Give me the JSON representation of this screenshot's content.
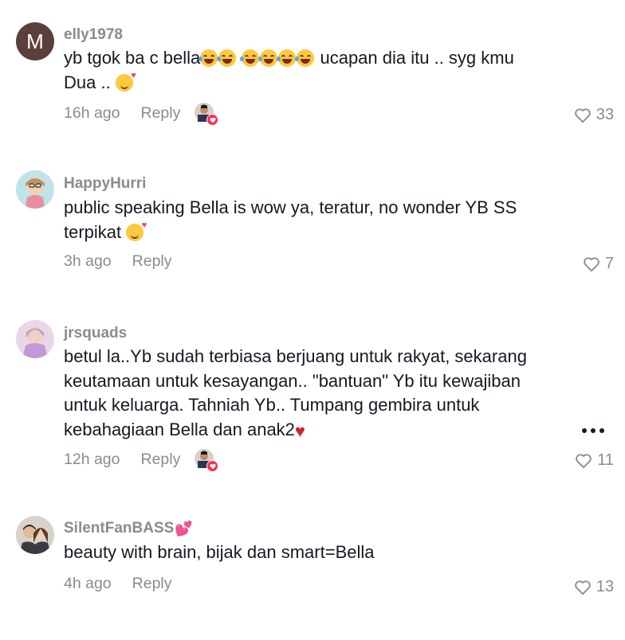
{
  "comments": [
    {
      "username": "elly1978",
      "avatar_letter": "M",
      "line1": "yb tgok ba c bella",
      "line1_after": " ucapan dia itu .. syg kmu",
      "line2": "Dua .. ",
      "time": "16h ago",
      "reply": "Reply",
      "likes": "33"
    },
    {
      "username": "HappyHurri",
      "line1": "public speaking Bella is wow ya, teratur, no wonder YB SS",
      "line2": "terpikat ",
      "time": "3h ago",
      "reply": "Reply",
      "likes": "7"
    },
    {
      "username": "jrsquads",
      "line1": "betul la..Yb sudah terbiasa berjuang untuk rakyat, sekarang",
      "line2": "keutamaan untuk kesayangan.. \"bantuan\" Yb itu kewajiban",
      "line3": "untuk keluarga. Tahniah Yb.. Tumpang gembira untuk",
      "line4": "kebahagiaan Bella dan anak2",
      "time": "12h ago",
      "reply": "Reply",
      "likes": "11"
    },
    {
      "username": "SilentFanBASS",
      "line1": "beauty with brain, bijak dan smart=Bella",
      "time": "4h ago",
      "reply": "Reply",
      "likes": "13"
    }
  ],
  "icons": {
    "like": "heart-outline-icon",
    "more": "more-dots-icon",
    "creator_liked": "creator-liked-badge"
  },
  "colors": {
    "text": "#161823",
    "muted": "#8a8b91",
    "accent": "#fe2c55"
  }
}
